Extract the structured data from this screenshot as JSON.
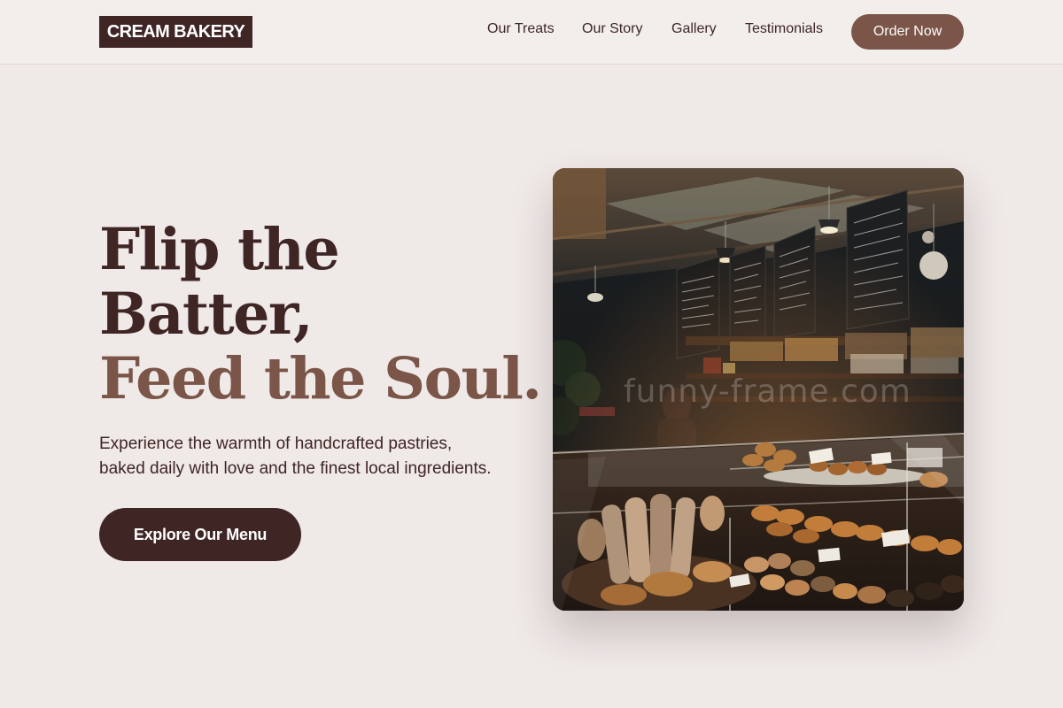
{
  "header": {
    "logo": "CREAM BAKERY",
    "nav": [
      "Our Treats",
      "Our Story",
      "Gallery",
      "Testimonials"
    ],
    "order_button": "Order Now"
  },
  "hero": {
    "title_line1": "Flip the",
    "title_line2": "Batter,",
    "title_line3": "Feed the Soul.",
    "subtitle_line1": "Experience the warmth of handcrafted pastries,",
    "subtitle_line2": "baked daily with love and the finest local ingredients.",
    "cta": "Explore Our Menu",
    "image_watermark": "funny-frame.com"
  },
  "colors": {
    "page_background": "#efe9e8",
    "header_background": "#f2eeec",
    "dark_brown": "#3f2625",
    "accent_brown": "#7a5548"
  },
  "icons": {
    "hero_image": "bakery-interior-photo"
  }
}
